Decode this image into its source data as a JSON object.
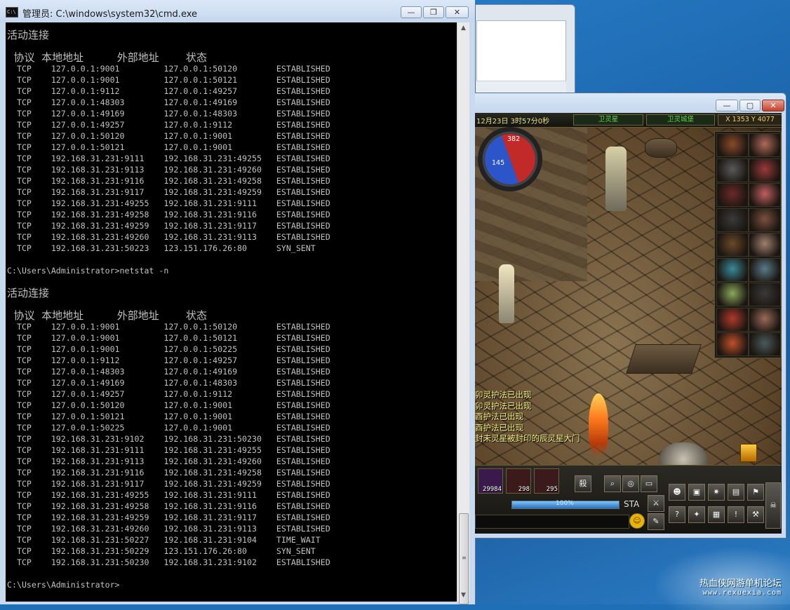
{
  "cmd_window": {
    "icon_text": "C:\\",
    "title": "管理员: C:\\windows\\system32\\cmd.exe",
    "buttons": {
      "minimize": "—",
      "maximize": "❐",
      "close": "✕"
    },
    "console_lines": [
      "活动连接",
      "",
      "  协议  本地地址          外部地址        状态",
      "  TCP    127.0.0.1:9001         127.0.0.1:50120        ESTABLISHED",
      "  TCP    127.0.0.1:9001         127.0.0.1:50121        ESTABLISHED",
      "  TCP    127.0.0.1:9112         127.0.0.1:49257        ESTABLISHED",
      "  TCP    127.0.0.1:48303        127.0.0.1:49169        ESTABLISHED",
      "  TCP    127.0.0.1:49169        127.0.0.1:48303        ESTABLISHED",
      "  TCP    127.0.0.1:49257        127.0.0.1:9112         ESTABLISHED",
      "  TCP    127.0.0.1:50120        127.0.0.1:9001         ESTABLISHED",
      "  TCP    127.0.0.1:50121        127.0.0.1:9001         ESTABLISHED",
      "  TCP    192.168.31.231:9111    192.168.31.231:49255   ESTABLISHED",
      "  TCP    192.168.31.231:9113    192.168.31.231:49260   ESTABLISHED",
      "  TCP    192.168.31.231:9116    192.168.31.231:49258   ESTABLISHED",
      "  TCP    192.168.31.231:9117    192.168.31.231:49259   ESTABLISHED",
      "  TCP    192.168.31.231:49255   192.168.31.231:9111    ESTABLISHED",
      "  TCP    192.168.31.231:49258   192.168.31.231:9116    ESTABLISHED",
      "  TCP    192.168.31.231:49259   192.168.31.231:9117    ESTABLISHED",
      "  TCP    192.168.31.231:49260   192.168.31.231:9113    ESTABLISHED",
      "  TCP    192.168.31.231:50223   123.151.176.26:80      SYN_SENT",
      "",
      "C:\\Users\\Administrator>netstat -n",
      "",
      "活动连接",
      "",
      "  协议  本地地址          外部地址        状态",
      "  TCP    127.0.0.1:9001         127.0.0.1:50120        ESTABLISHED",
      "  TCP    127.0.0.1:9001         127.0.0.1:50121        ESTABLISHED",
      "  TCP    127.0.0.1:9001         127.0.0.1:50225        ESTABLISHED",
      "  TCP    127.0.0.1:9112         127.0.0.1:49257        ESTABLISHED",
      "  TCP    127.0.0.1:48303        127.0.0.1:49169        ESTABLISHED",
      "  TCP    127.0.0.1:49169        127.0.0.1:48303        ESTABLISHED",
      "  TCP    127.0.0.1:49257        127.0.0.1:9112         ESTABLISHED",
      "  TCP    127.0.0.1:50120        127.0.0.1:9001         ESTABLISHED",
      "  TCP    127.0.0.1:50121        127.0.0.1:9001         ESTABLISHED",
      "  TCP    127.0.0.1:50225        127.0.0.1:9001         ESTABLISHED",
      "  TCP    192.168.31.231:9102    192.168.31.231:50230   ESTABLISHED",
      "  TCP    192.168.31.231:9111    192.168.31.231:49255   ESTABLISHED",
      "  TCP    192.168.31.231:9113    192.168.31.231:49260   ESTABLISHED",
      "  TCP    192.168.31.231:9116    192.168.31.231:49258   ESTABLISHED",
      "  TCP    192.168.31.231:9117    192.168.31.231:49259   ESTABLISHED",
      "  TCP    192.168.31.231:49255   192.168.31.231:9111    ESTABLISHED",
      "  TCP    192.168.31.231:49258   192.168.31.231:9116    ESTABLISHED",
      "  TCP    192.168.31.231:49259   192.168.31.231:9117    ESTABLISHED",
      "  TCP    192.168.31.231:49260   192.168.31.231:9113    ESTABLISHED",
      "  TCP    192.168.31.231:50227   192.168.31.231:9104    TIME_WAIT",
      "  TCP    192.168.31.231:50229   123.151.176.26:80      SYN_SENT",
      "  TCP    192.168.31.231:50230   192.168.31.231:9102    ESTABLISHED",
      "",
      "C:\\Users\\Administrator>"
    ],
    "scroll_up": "▲",
    "scroll_down": "▼"
  },
  "game_window": {
    "buttons": {
      "minimize": "—",
      "maximize": "▢",
      "close": "✕"
    },
    "hud": {
      "date_time": "12月23日  3时57分0秒",
      "map_name": "卫灵星",
      "zone_name": "卫灵城堡",
      "x_label": "X",
      "x_value": "1353",
      "y_label": "Y",
      "y_value": "4077",
      "hp": "382",
      "mp": "145"
    },
    "chat_messages": [
      "卯灵护法已出现",
      "卯灵护法已出现",
      "酉护法已出现",
      "酉护法已出现",
      "封未灵星被封印的辰灵星大门"
    ],
    "items": [
      {
        "count": "29984",
        "color": "#6a2a7a"
      },
      {
        "count": "298",
        "color": "#8a1a1a"
      },
      {
        "count": "295",
        "color": "#8a1a1a"
      }
    ],
    "kill_label": "殺",
    "exp_percent": "100%",
    "exp_fraction": 1.0,
    "sta_label": "STA",
    "emoji": "☺"
  },
  "watermark": {
    "line1": "热血侠网游单机论坛",
    "line2": "www.rexuexia.com"
  }
}
